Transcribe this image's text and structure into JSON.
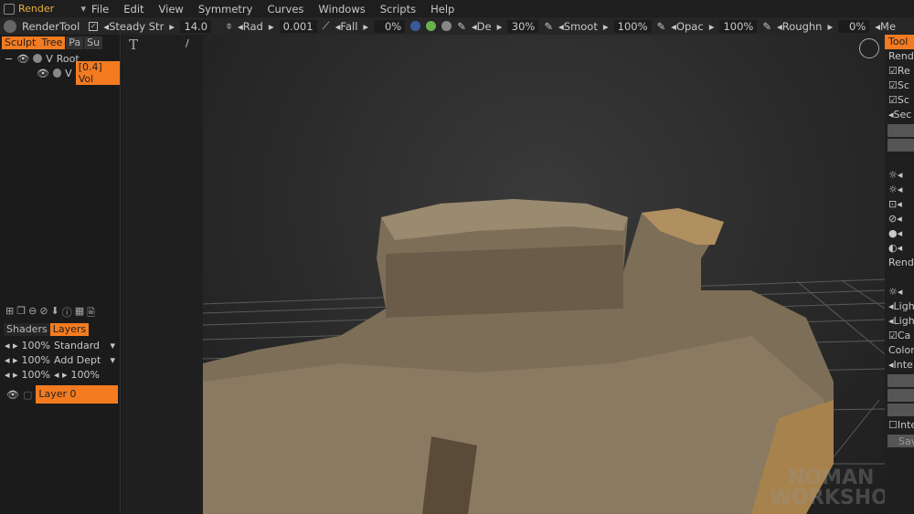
{
  "menubar": {
    "mode": "Render",
    "items": [
      "File",
      "Edit",
      "View",
      "Symmetry",
      "Curves",
      "Windows",
      "Scripts",
      "Help"
    ]
  },
  "toolbar": {
    "tool": "RenderTool",
    "steady": "Steady Str",
    "steady_value": "14.0",
    "rad": "Rad",
    "rad_value": "0.001",
    "fall": "Fall",
    "fall_value": "0%",
    "de": "De",
    "de_value": "30%",
    "smooth": "Smoot",
    "smooth_value": "100%",
    "opac": "Opac",
    "opac_value": "100%",
    "rough": "Roughn",
    "rough_value": "0%",
    "more": "Me"
  },
  "left": {
    "tabs": [
      "Sculpt",
      "Tree",
      "Pa",
      "Su"
    ],
    "tree": [
      {
        "label": "Root"
      },
      {
        "label": "[0.4]  Vol"
      }
    ],
    "layer_tabs": [
      "Shaders",
      "Layers"
    ],
    "layer_rows": [
      [
        "100%",
        "Standard"
      ],
      [
        "100%",
        "Add  Dept"
      ],
      [
        "100%",
        "100%"
      ]
    ],
    "layer": "Layer  0"
  },
  "right": {
    "tab": "Tool",
    "items": [
      "Rende",
      "Re",
      "Sc",
      "Sc",
      "Sec",
      "Rende",
      "Ligh",
      "Ligh",
      "Ca",
      "Color",
      "Inte",
      "Inte",
      "Sav"
    ]
  },
  "watermark": [
    "NOMAN",
    "WORKSHOP"
  ]
}
